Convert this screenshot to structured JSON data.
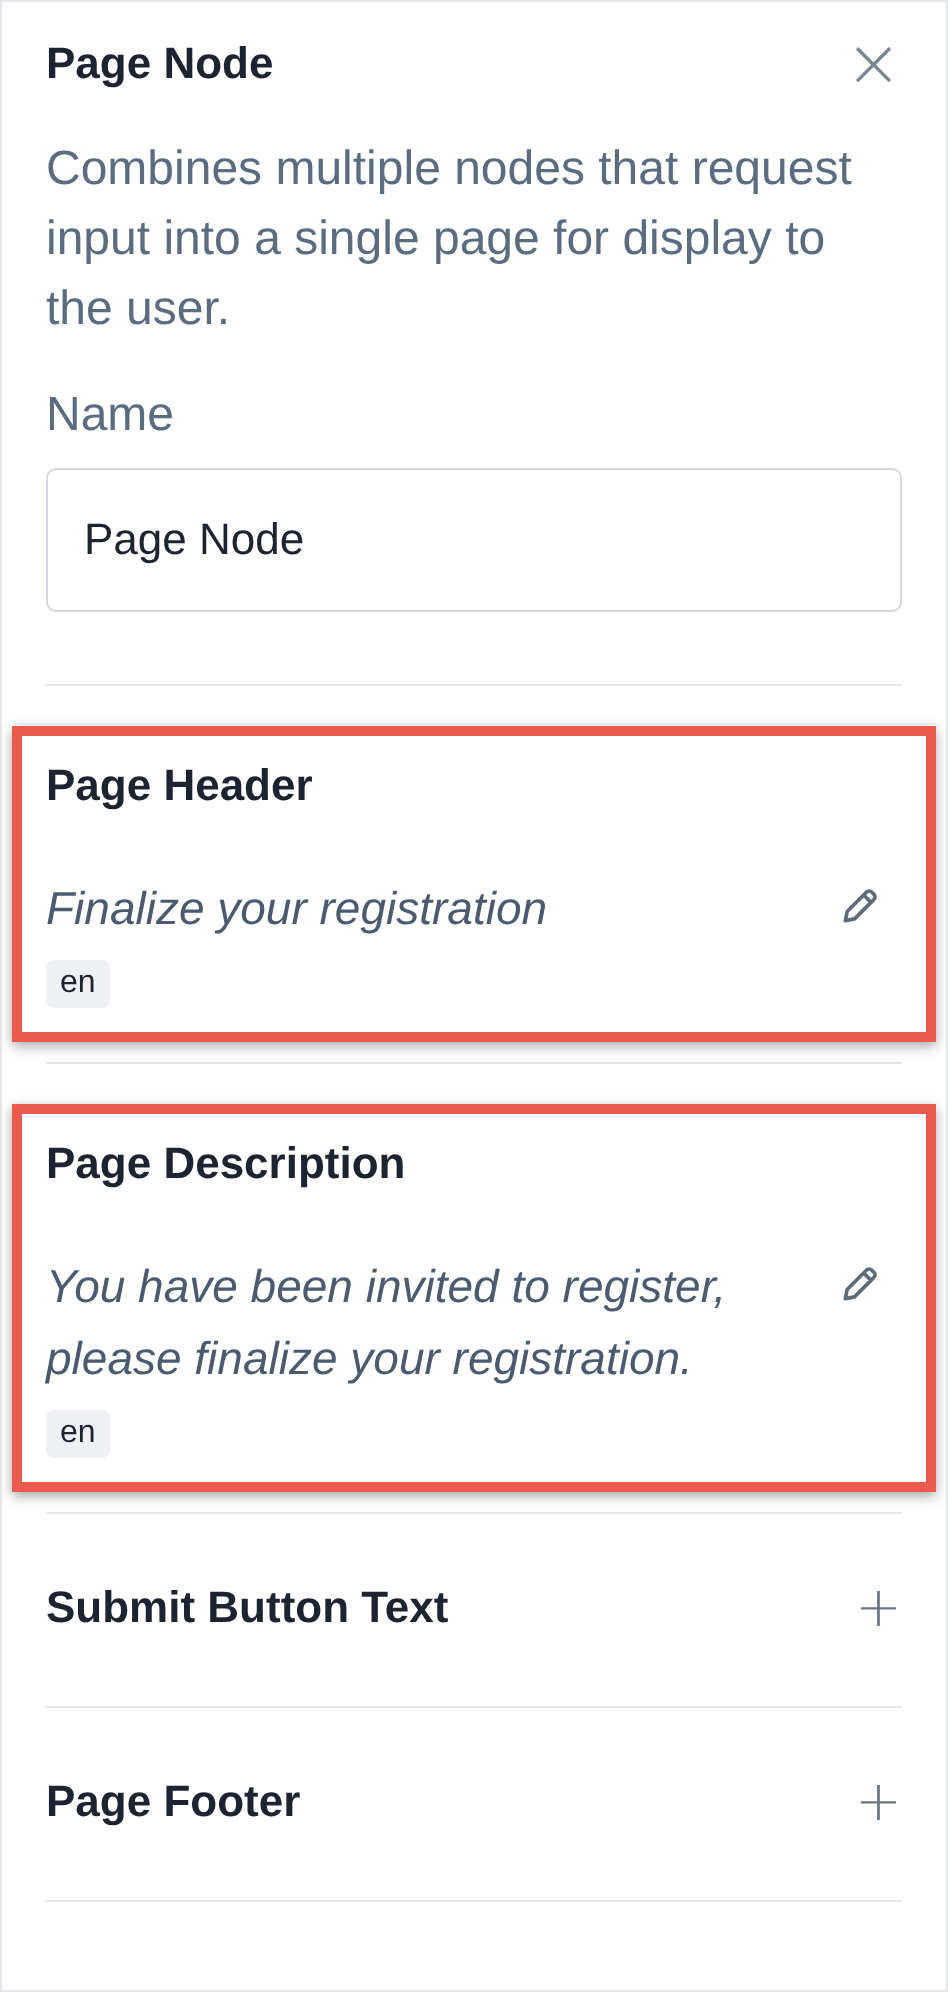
{
  "panel": {
    "title": "Page Node",
    "close": "×",
    "description": "Combines multiple nodes that request input into a single page for display to the user.",
    "name_label": "Name",
    "name_value": "Page Node"
  },
  "sections": [
    {
      "kind": "text",
      "title": "Page Header",
      "highlighted": true,
      "value": "Finalize your registration",
      "language": "en"
    },
    {
      "kind": "text",
      "title": "Page Description",
      "highlighted": true,
      "value": "You have been invited to register, please finalize your registration.",
      "language": "en"
    },
    {
      "kind": "add",
      "title": "Submit Button Text",
      "highlighted": false,
      "action": "+"
    },
    {
      "kind": "add",
      "title": "Page Footer",
      "highlighted": false,
      "action": "+"
    }
  ]
}
